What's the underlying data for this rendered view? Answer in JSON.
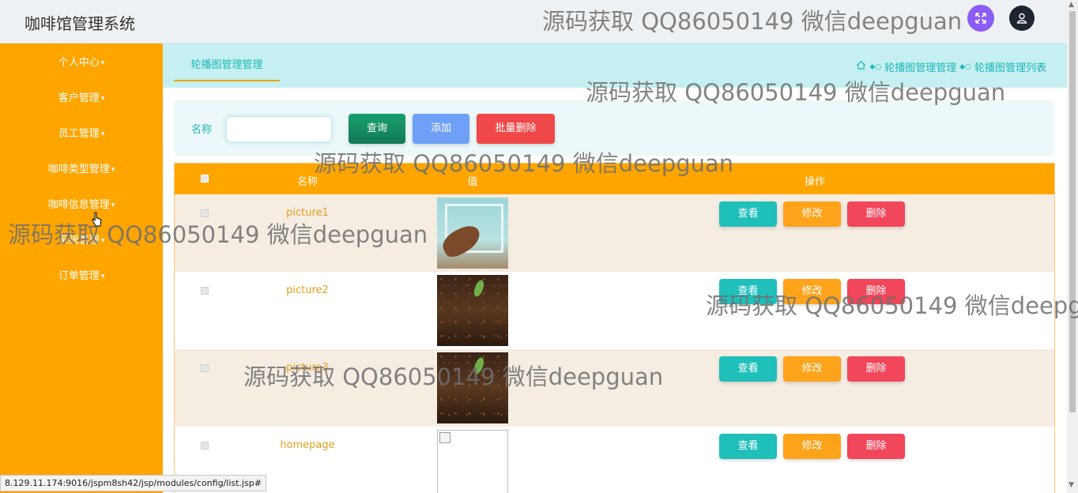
{
  "app": {
    "title": "咖啡馆管理系统"
  },
  "header": {
    "expand_icon": "expand-icon",
    "user_icon": "user-icon"
  },
  "sidebar": {
    "items": [
      {
        "label": "个人中心"
      },
      {
        "label": "客户管理"
      },
      {
        "label": "员工管理"
      },
      {
        "label": "咖啡类型管理"
      },
      {
        "label": "咖啡信息管理"
      },
      {
        "label": "系统管理"
      },
      {
        "label": "订单管理"
      }
    ]
  },
  "tabs": {
    "active": "轮播图管理管理"
  },
  "breadcrumb": {
    "items": [
      "轮播图管理管理",
      "轮播图管理列表"
    ]
  },
  "search": {
    "label": "名称",
    "value": "",
    "query_label": "查询",
    "add_label": "添加",
    "batch_delete_label": "批量删除"
  },
  "table": {
    "headers": {
      "name": "名称",
      "value": "值",
      "action": "操作"
    },
    "rows": [
      {
        "name": "picture1",
        "image": "picture1-thumbnail"
      },
      {
        "name": "picture2",
        "image": "coffee-beans-thumbnail"
      },
      {
        "name": "picture3",
        "image": "coffee-beans-thumbnail"
      },
      {
        "name": "homepage",
        "image": "broken-image"
      }
    ],
    "actions": {
      "view": "查看",
      "edit": "修改",
      "delete": "删除"
    }
  },
  "status_url": "8.129.11.174:9016/jspm8sh42/jsp/modules/config/list.jsp#",
  "watermark": "源码获取 QQ86050149 微信deepguan",
  "colors": {
    "sidebar": "#ffa500",
    "table_header": "#ffa500",
    "tab_bar": "#c5eff0",
    "accent_teal": "#1fb8b8",
    "view_button": "#1fbfba",
    "edit_button": "#ffa31a",
    "delete_button": "#f2465a"
  }
}
